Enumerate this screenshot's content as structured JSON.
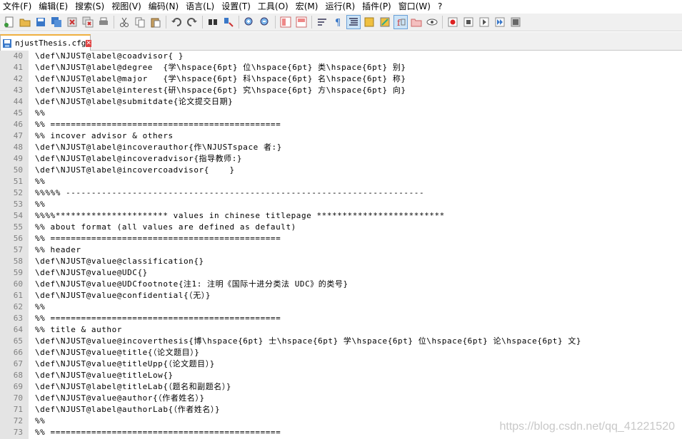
{
  "menu": [
    "文件(F)",
    "编辑(E)",
    "搜索(S)",
    "视图(V)",
    "编码(N)",
    "语言(L)",
    "设置(T)",
    "工具(O)",
    "宏(M)",
    "运行(R)",
    "插件(P)",
    "窗口(W)",
    "?"
  ],
  "toolbar": {
    "groups": [
      [
        "new-file-icon",
        "open-file-icon",
        "save-icon",
        "save-all-icon",
        "close-icon",
        "close-all-icon",
        "print-icon"
      ],
      [
        "cut-icon",
        "copy-icon",
        "paste-icon"
      ],
      [
        "undo-icon",
        "redo-icon"
      ],
      [
        "find-icon",
        "replace-icon"
      ],
      [
        "zoom-in-icon",
        "zoom-out-icon"
      ],
      [
        "sync-vertical-icon",
        "sync-horizontal-icon"
      ],
      [
        "word-wrap-icon",
        "show-all-chars-icon",
        "indent-guide-icon",
        "user-lang-icon",
        "doc-map-icon",
        "function-list-icon",
        "folder-workspace-icon",
        "monitor-icon"
      ],
      [
        "record-macro-icon",
        "stop-macro-icon",
        "play-macro-icon",
        "run-macro-multiple-icon",
        "save-macro-icon"
      ]
    ],
    "active": [
      "indent-guide-icon",
      "function-list-icon"
    ]
  },
  "tab": {
    "label": "njustThesis.cfg",
    "close": "✕"
  },
  "editor": {
    "lines": [
      {
        "n": "40",
        "t": "\\def\\NJUST@label@coadvisor{ }"
      },
      {
        "n": "41",
        "t": "\\def\\NJUST@label@degree  {学\\hspace{6pt} 位\\hspace{6pt} 类\\hspace{6pt} 别}"
      },
      {
        "n": "42",
        "t": "\\def\\NJUST@label@major   {学\\hspace{6pt} 科\\hspace{6pt} 名\\hspace{6pt} 称}"
      },
      {
        "n": "43",
        "t": "\\def\\NJUST@label@interest{研\\hspace{6pt} 究\\hspace{6pt} 方\\hspace{6pt} 向}"
      },
      {
        "n": "44",
        "t": "\\def\\NJUST@label@submitdate{论文提交日期}"
      },
      {
        "n": "45",
        "t": "%%"
      },
      {
        "n": "46",
        "t": "%% ============================================="
      },
      {
        "n": "47",
        "t": "%% incover advisor & others"
      },
      {
        "n": "48",
        "t": "\\def\\NJUST@label@incoverauthor{作\\NJUSTspace 者:}"
      },
      {
        "n": "49",
        "t": "\\def\\NJUST@label@incoveradvisor{指导教师:}"
      },
      {
        "n": "50",
        "t": "\\def\\NJUST@label@incovercoadvisor{    }"
      },
      {
        "n": "51",
        "t": "%%"
      },
      {
        "n": "52",
        "t": "%%%%% ----------------------------------------------------------------------"
      },
      {
        "n": "53",
        "t": "%%"
      },
      {
        "n": "54",
        "t": "%%%%********************** values in chinese titlepage *************************"
      },
      {
        "n": "55",
        "t": "%% about format (all values are defined as default)"
      },
      {
        "n": "56",
        "t": "%% ============================================="
      },
      {
        "n": "57",
        "t": "%% header"
      },
      {
        "n": "58",
        "t": "\\def\\NJUST@value@classification{}"
      },
      {
        "n": "59",
        "t": "\\def\\NJUST@value@UDC{}"
      },
      {
        "n": "60",
        "t": "\\def\\NJUST@value@UDCfootnote{注1: 注明《国际十进分类法 UDC》的类号}"
      },
      {
        "n": "61",
        "t": "\\def\\NJUST@value@confidential{（无）}"
      },
      {
        "n": "62",
        "t": "%%"
      },
      {
        "n": "63",
        "t": "%% ============================================="
      },
      {
        "n": "64",
        "t": "%% title & author"
      },
      {
        "n": "65",
        "t": "\\def\\NJUST@value@incoverthesis{博\\hspace{6pt} 士\\hspace{6pt} 学\\hspace{6pt} 位\\hspace{6pt} 论\\hspace{6pt} 文}"
      },
      {
        "n": "66",
        "t": "\\def\\NJUST@value@title{（论文题目）}"
      },
      {
        "n": "67",
        "t": "\\def\\NJUST@value@titleUpp{（论文题目）}"
      },
      {
        "n": "68",
        "t": "\\def\\NJUST@value@titleLow{}"
      },
      {
        "n": "69",
        "t": "\\def\\NJUST@label@titleLab{（题名和副题名）}"
      },
      {
        "n": "70",
        "t": "\\def\\NJUST@value@author{（作者姓名）}"
      },
      {
        "n": "71",
        "t": "\\def\\NJUST@label@authorLab{（作者姓名）}"
      },
      {
        "n": "72",
        "t": "%%"
      },
      {
        "n": "73",
        "t": "%% ============================================="
      }
    ]
  },
  "watermark": "https://blog.csdn.net/qq_41221520"
}
